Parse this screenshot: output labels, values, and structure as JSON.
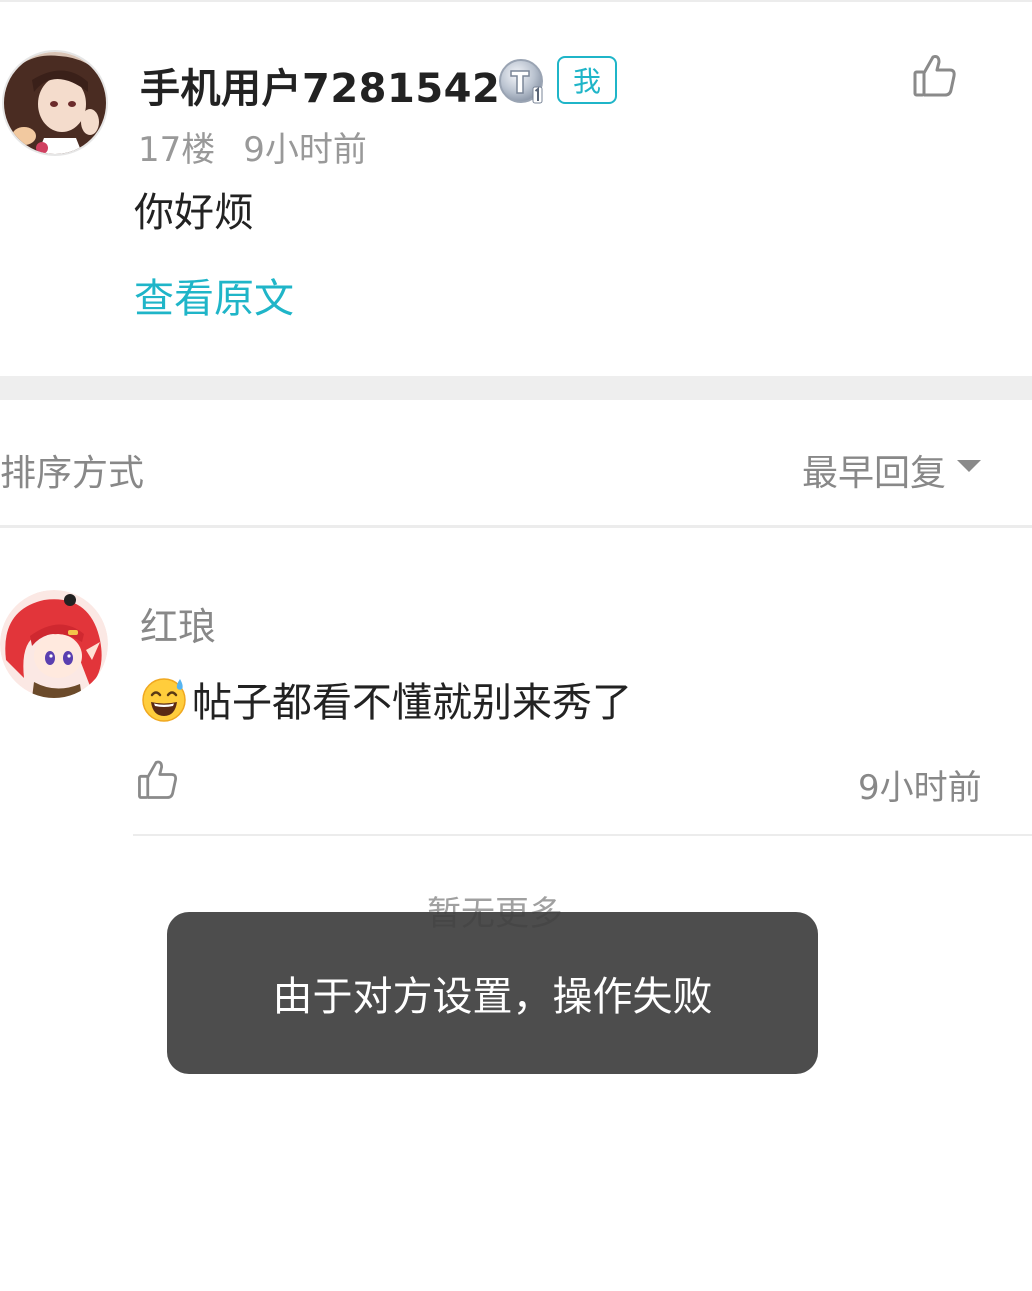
{
  "post": {
    "username": "手机用户7281542",
    "level_badge": "T1",
    "me_badge": "我",
    "floor": "17楼",
    "time": "9小时前",
    "content": "你好烦",
    "view_original": "查看原文"
  },
  "sort": {
    "label": "排序方式",
    "value": "最早回复"
  },
  "reply": {
    "username": "红琅",
    "content": "帖子都看不懂就别来秀了",
    "time": "9小时前"
  },
  "footer": {
    "no_more": "暂无更多"
  },
  "toast": {
    "message": "由于对方设置，操作失败"
  },
  "colors": {
    "accent": "#1fb5c8",
    "secondary_text": "#999999",
    "divider": "#eeeeee",
    "toast_bg": "#404040"
  },
  "icons": {
    "level": "level-t1-icon",
    "like": "thumbs-up-icon",
    "sort": "caret-down-icon",
    "emoji": "sweat-smile-emoji-icon"
  }
}
